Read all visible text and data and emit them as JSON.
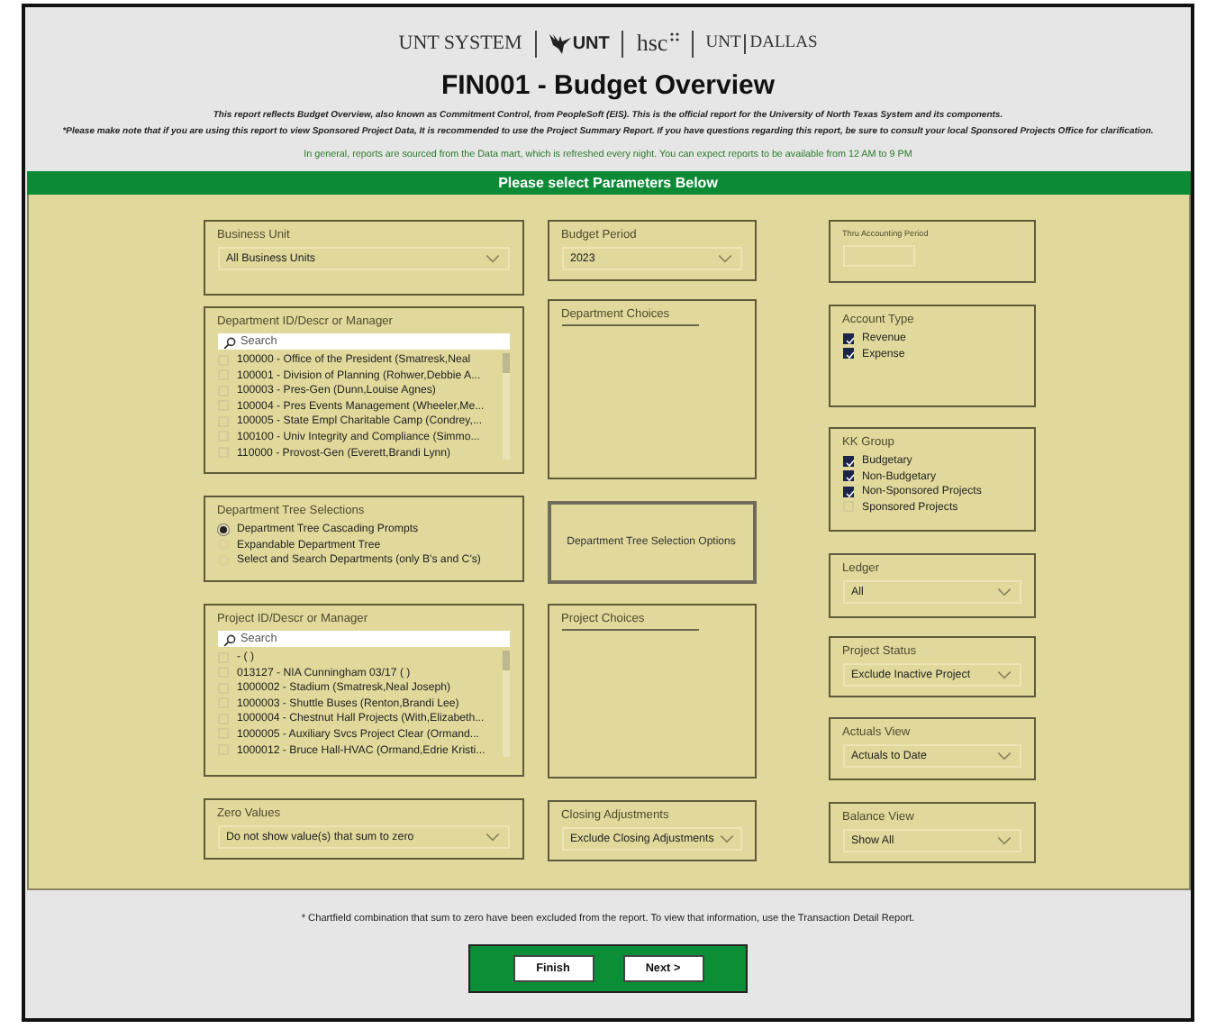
{
  "header": {
    "logos": [
      {
        "kind": "plain",
        "text": "UNT SYSTEM"
      },
      {
        "kind": "eagle",
        "text": "UNT"
      },
      {
        "kind": "hsc",
        "text": "hsc"
      },
      {
        "kind": "split",
        "parts": [
          "UNT",
          "DALLAS"
        ]
      }
    ],
    "title": "FIN001 - Budget Overview",
    "notes": [
      "This report reflects Budget Overview, also known as Commitment Control, from PeopleSoft (EIS). This is the official report for the University of North Texas System and its components.",
      "*Please make note that if you are using this report to view Sponsored Project Data, It is recommended to use the Project Summary Report. If you have questions regarding this report, be sure to consult your local Sponsored Projects Office for clarification."
    ],
    "info": "In general, reports are sourced from the Data mart, which is refreshed every night. You can expect reports to be available from 12 AM to 9 PM"
  },
  "parameters_bar": "Please select Parameters Below",
  "columns": [
    [
      {
        "kind": "dropdown",
        "label": "Business Unit",
        "value": "All Business Units"
      },
      {
        "kind": "list",
        "label": "Department ID/Descr or Manager",
        "placeholder": "Search",
        "items": [
          {
            "text": "100000 - Office of the President (Smatresk,Neal",
            "checked": false
          },
          {
            "text": "100001 - Division of Planning (Rohwer,Debbie A...",
            "checked": false
          },
          {
            "text": "100003 - Pres-Gen (Dunn,Louise Agnes)",
            "checked": false
          },
          {
            "text": "100004 - Pres Events Management (Wheeler,Me...",
            "checked": false
          },
          {
            "text": "100005 - State Empl Charitable Camp (Condrey,...",
            "checked": false
          },
          {
            "text": "100100 - Univ Integrity and Compliance (Simmo...",
            "checked": false
          },
          {
            "text": "110000 - Provost-Gen (Everett,Brandi Lynn)",
            "checked": false
          }
        ]
      },
      {
        "kind": "radio",
        "label": "Department Tree Selections",
        "items": [
          {
            "text": "Department Tree Cascading Prompts",
            "selected": true
          },
          {
            "text": "Expandable Department Tree",
            "selected": false
          },
          {
            "text": "Select and Search Departments (only B's and C's)",
            "selected": false
          }
        ]
      },
      {
        "kind": "list",
        "label": "Project ID/Descr or Manager",
        "placeholder": "Search",
        "items": [
          {
            "text": "- ( )",
            "checked": false
          },
          {
            "text": "013127 - NIA Cunningham 03/17 ( )",
            "checked": false
          },
          {
            "text": "1000002 - Stadium (Smatresk,Neal Joseph)",
            "checked": false
          },
          {
            "text": "1000003 - Shuttle Buses (Renton,Brandi Lee)",
            "checked": false
          },
          {
            "text": "1000004 - Chestnut Hall Projects (With,Elizabeth...",
            "checked": false
          },
          {
            "text": "1000005 - Auxiliary Svcs Project Clear (Ormand...",
            "checked": false
          },
          {
            "text": "1000012 - Bruce Hall-HVAC (Ormand,Edrie Kristi...",
            "checked": false
          }
        ]
      },
      {
        "kind": "dropdown",
        "label": "Zero Values",
        "value": "Do not show value(s) that sum to zero"
      }
    ],
    [
      {
        "kind": "dropdown",
        "label": "Budget Period",
        "value": "2023"
      },
      {
        "kind": "choices",
        "label": "Department Choices"
      },
      {
        "kind": "button",
        "label": "Department Tree Selection Options"
      },
      {
        "kind": "choices",
        "label": "Project Choices"
      },
      {
        "kind": "dropdown",
        "label": "Closing Adjustments",
        "value": "Exclude Closing Adjustments"
      }
    ],
    [
      {
        "kind": "input",
        "label": "Thru Accounting Period"
      },
      {
        "kind": "checklist",
        "label": "Account Type",
        "items": [
          {
            "text": "Revenue",
            "checked": true
          },
          {
            "text": "Expense",
            "checked": true
          }
        ]
      },
      {
        "kind": "checklist",
        "label": "KK Group",
        "items": [
          {
            "text": "Budgetary",
            "checked": true
          },
          {
            "text": "Non-Budgetary",
            "checked": true
          },
          {
            "text": "Non-Sponsored Projects",
            "checked": true
          },
          {
            "text": "Sponsored Projects",
            "checked": false
          }
        ]
      },
      {
        "kind": "dropdown",
        "label": "Ledger",
        "value": "All"
      },
      {
        "kind": "dropdown",
        "label": "Project Status",
        "value": "Exclude Inactive Project"
      },
      {
        "kind": "dropdown",
        "label": "Actuals View",
        "value": "Actuals to Date"
      },
      {
        "kind": "dropdown",
        "label": "Balance View",
        "value": "Show All"
      }
    ]
  ],
  "footnote": "* Chartfield combination that sum to zero have been excluded from the report. To view that information, use the Transaction Detail Report.",
  "buttons": [
    "Finish",
    "Next >"
  ]
}
